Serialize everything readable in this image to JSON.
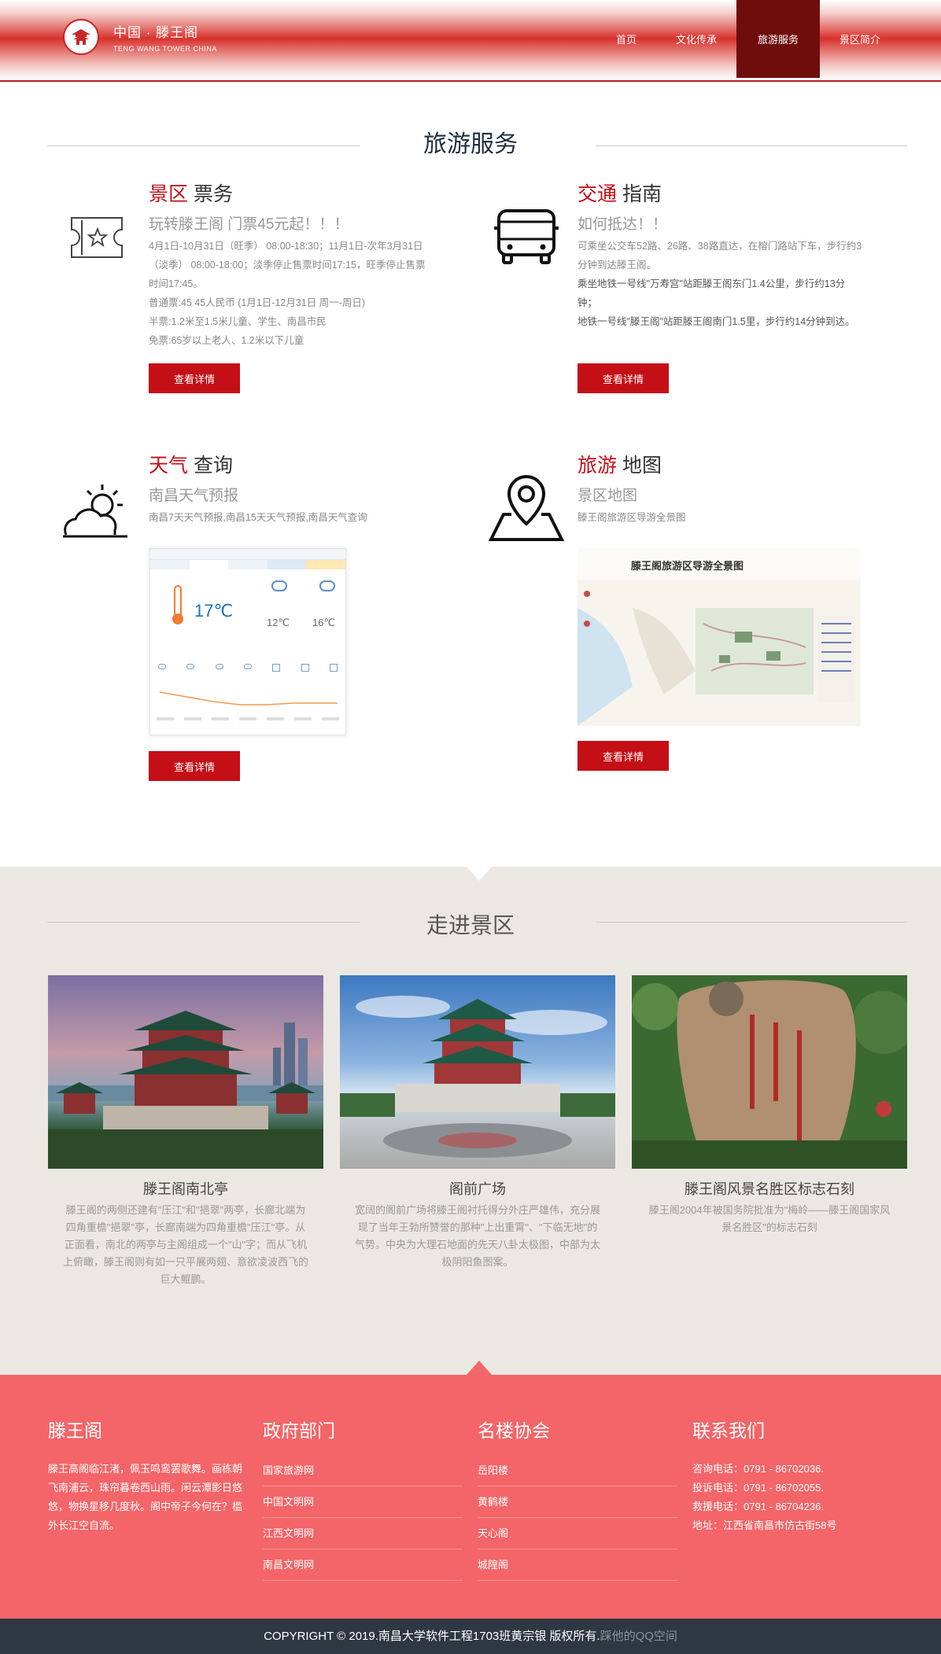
{
  "header": {
    "logo_cn": "中国 · 滕王阁",
    "logo_en": "TENG WANG TOWER   CHINA",
    "nav": [
      "首页",
      "文化传承",
      "旅游服务",
      "景区简介"
    ],
    "active_nav": "旅游服务"
  },
  "services": {
    "title": "旅游服务",
    "tickets": {
      "title_red": "景区",
      "title_rest": "票务",
      "subtitle": "玩转滕王阁    门票45元起！！！",
      "lines": [
        "4月1日-10月31日（旺季） 08:00-18:30；11月1日-次年3月31日（淡季） 08:00-18:00；淡季停止售票时间17:15，旺季停止售票时间17:45。",
        "普通票:45  45人民币 (1月1日-12月31日 周一-周日)",
        "半票:1.2米至1.5米儿童、学生、南昌市民",
        "免票:65岁以上老人、1.2米以下儿童"
      ],
      "button": "查看详情"
    },
    "transport": {
      "title_red": "交通",
      "title_rest": "指南",
      "subtitle": "如何抵达！！",
      "lines": [
        "可乘坐公交车52路、26路、38路直达，在榕门路站下车，步行约3分钟到达滕王阁。",
        "乘坐地铁一号线\"万寿宫\"站距滕王阁东门1.4公里，步行约13分钟；",
        "地铁一号线\"滕王阁\"站距滕王阁南门1.5里，步行约14分钟到达。"
      ],
      "button": "查看详情"
    },
    "weather": {
      "title_red": "天气",
      "title_rest": "查询",
      "subtitle": "南昌天气预报",
      "line": "南昌7天天气预报,南昌15天天气预报,南昌天气查询",
      "temp_now": "17℃",
      "temp_2": "12℃",
      "temp_3": "16℃",
      "button": "查看详情"
    },
    "map": {
      "title_red": "旅游",
      "title_rest": "地图",
      "subtitle": "景区地图",
      "line": "滕王阁旅游区导游全景图",
      "map_heading": "滕王阁旅游区导游全景图",
      "button": "查看详情"
    }
  },
  "scenic": {
    "title": "走进景区",
    "items": [
      {
        "title": "滕王阁南北亭",
        "desc": "滕王阁的两侧还建有\"压江\"和\"挹翠\"两亭，长廊北端为四角重檐\"挹翠\"亭，长廊南端为四角重檐\"压江\"亭。从正面看，南北的两亭与主阁组成一个\"山\"字；而从飞机上俯瞰，滕王阁则有如一只平展两翅、意欲凌波西飞的巨大鲲鹏。"
      },
      {
        "title": "阁前广场",
        "desc": "宽阔的阁前广场将滕王阁衬托得分外庄严雄伟，充分展现了当年王勃所赞誉的那种\"上出重霄\"、\"下临无地\"的气势。中央为大理石地面的先天八卦太极图，中部为太极阴阳鱼图案。"
      },
      {
        "title": "滕王阁风景名胜区标志石刻",
        "desc": "滕王阁2004年被国务院批准为\"梅岭——滕王阁国家风景名胜区\"的标志石刻"
      }
    ]
  },
  "footer": {
    "about": {
      "title": "滕王阁",
      "text": "滕王高阁临江渚，佩玉鸣鸾罢歌舞。画栋朝飞南浦云，珠帘暮卷西山雨。闲云潭影日悠悠，物换星移几度秋。阁中帝子今何在？槛外长江空自流。"
    },
    "gov": {
      "title": "政府部门",
      "links": [
        "国家旅游网",
        "中国文明网",
        "江西文明网",
        "南昌文明网"
      ]
    },
    "towers": {
      "title": "名楼协会",
      "links": [
        "岳阳楼",
        "黄鹤楼",
        "天心阁",
        "城隍阁"
      ]
    },
    "contact": {
      "title": "联系我们",
      "lines": [
        "咨询电话：0791 - 86702036.",
        "投诉电话：0791 - 86702055.",
        "救援电话：0791 - 86704236.",
        "地址：江西省南昌市仿古街58号"
      ]
    },
    "copyright": "COPYRIGHT © 2019.南昌大学软件工程1703班黄宗银 版权所有.",
    "copyright_link": "踩他的QQ空间"
  },
  "colors": {
    "accent": "#c40f16",
    "footer": "#f36568",
    "gray_section": "#ebe8e3",
    "copyright_bar": "#2f3743"
  }
}
